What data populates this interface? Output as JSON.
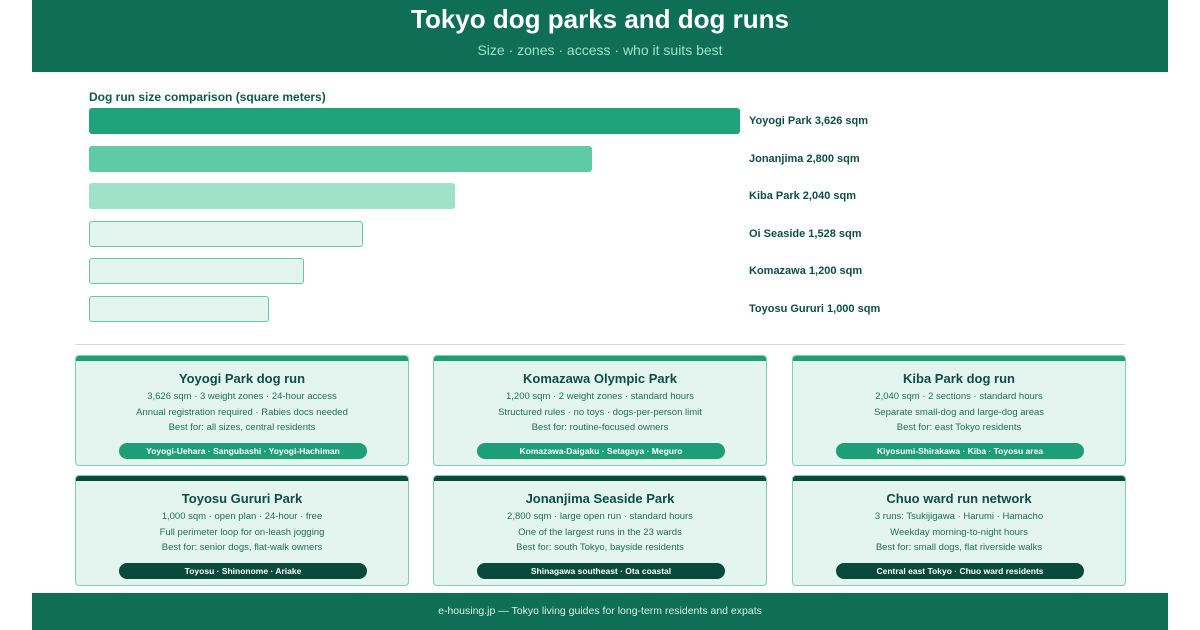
{
  "header": {
    "title": "Tokyo dog parks and dog runs",
    "subtitle": "Size · zones · access · who it suits best"
  },
  "chart_data": {
    "type": "bar",
    "title": "Dog run size comparison (square meters)",
    "categories": [
      "Yoyogi Park",
      "Jonanjima",
      "Kiba Park",
      "Oi Seaside",
      "Komazawa",
      "Toyosu Gururi"
    ],
    "values": [
      3626,
      2800,
      2040,
      1528,
      1200,
      1000
    ],
    "labels": [
      "Yoyogi Park 3,626 sqm",
      "Jonanjima 2,800 sqm",
      "Kiba Park 2,040 sqm",
      "Oi Seaside 1,528 sqm",
      "Komazawa 1,200 sqm",
      "Toyosu Gururi 1,000 sqm"
    ],
    "xlabel": "",
    "ylabel": "",
    "grid": false,
    "colors": [
      "#1fa37a",
      "#5ecba6",
      "#9fe1c9",
      "#e3f5ee",
      "#e3f5ee",
      "#e3f5ee"
    ],
    "outline_color": "#5ecba6"
  },
  "cards": [
    {
      "title": "Yoyogi Park dog run",
      "line1": "3,626 sqm · 3 weight zones · 24-hour access",
      "line2": "Annual registration required · Rabies docs needed",
      "line3": "Best for: all sizes, central residents",
      "pill": "Yoyogi-Uehara · Sangubashi · Yoyogi-Hachiman",
      "accent": "#1d9e75"
    },
    {
      "title": "Komazawa Olympic Park",
      "line1": "1,200 sqm · 2 weight zones · standard hours",
      "line2": "Structured rules · no toys · dogs-per-person limit",
      "line3": "Best for: routine-focused owners",
      "pill": "Komazawa-Daigaku · Setagaya · Meguro",
      "accent": "#1d9e75"
    },
    {
      "title": "Kiba Park dog run",
      "line1": "2,040 sqm · 2 sections · standard hours",
      "line2": "Separate small-dog and large-dog areas",
      "line3": "Best for: east Tokyo residents",
      "pill": "Kiyosumi-Shirakawa · Kiba · Toyosu area",
      "accent": "#1d9e75"
    },
    {
      "title": "Toyosu Gururi Park",
      "line1": "1,000 sqm · open plan · 24-hour · free",
      "line2": "Full perimeter loop for on-leash jogging",
      "line3": "Best for: senior dogs, flat-walk owners",
      "pill": "Toyosu · Shinonome · Ariake",
      "accent": "#0a4a3a"
    },
    {
      "title": "Jonanjima Seaside Park",
      "line1": "2,800 sqm · large open run · standard hours",
      "line2": "One of the largest runs in the 23 wards",
      "line3": "Best for: south Tokyo, bayside residents",
      "pill": "Shinagawa southeast · Ota coastal",
      "accent": "#0a4a3a"
    },
    {
      "title": "Chuo ward run network",
      "line1": "3 runs: Tsukijigawa · Harumi · Hamacho",
      "line2": "Weekday morning-to-night hours",
      "line3": "Best for: small dogs, flat riverside walks",
      "pill": "Central east Tokyo · Chuo ward residents",
      "accent": "#0a4a3a"
    }
  ],
  "footer": {
    "text": "e-housing.jp — Tokyo living guides for long-term residents and expats"
  }
}
